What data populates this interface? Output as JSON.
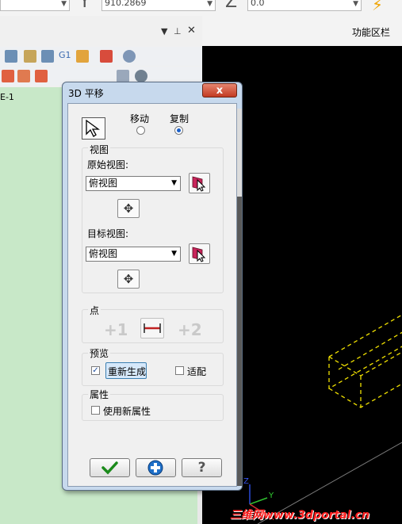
{
  "coords": {
    "x_value": "",
    "y_axis": "Y",
    "y_value": "910.2869",
    "z_axis": "Z",
    "z_value": "0.0"
  },
  "panel": {
    "func_bar_label": "功能区栏",
    "tree_label": "E-1"
  },
  "dialog": {
    "title": "3D 平移",
    "close_label": "x",
    "mode": {
      "move_label": "移动",
      "copy_label": "复制",
      "selected": "copy"
    },
    "view_group": {
      "title": "视图",
      "original_label": "原始视图:",
      "original_value": "俯视图",
      "target_label": "目标视图:",
      "target_value": "俯视图"
    },
    "point_group": {
      "title": "点"
    },
    "preview_group": {
      "title": "预览",
      "regenerate_label": "重新生成",
      "regenerate_checked": true,
      "fit_label": "适配",
      "fit_checked": false
    },
    "attr_group": {
      "title": "属性",
      "use_new_label": "使用新属性",
      "use_new_checked": false
    },
    "buttons": {
      "ok_icon": "checkmark-icon",
      "apply_icon": "plus-icon",
      "help_label": "?"
    }
  },
  "watermark": "三维网www.3dportal.cn",
  "colors": {
    "viewport_bg": "#000000",
    "wire_yellow": "#f0e000",
    "tree_bg": "#c8e8c8"
  }
}
